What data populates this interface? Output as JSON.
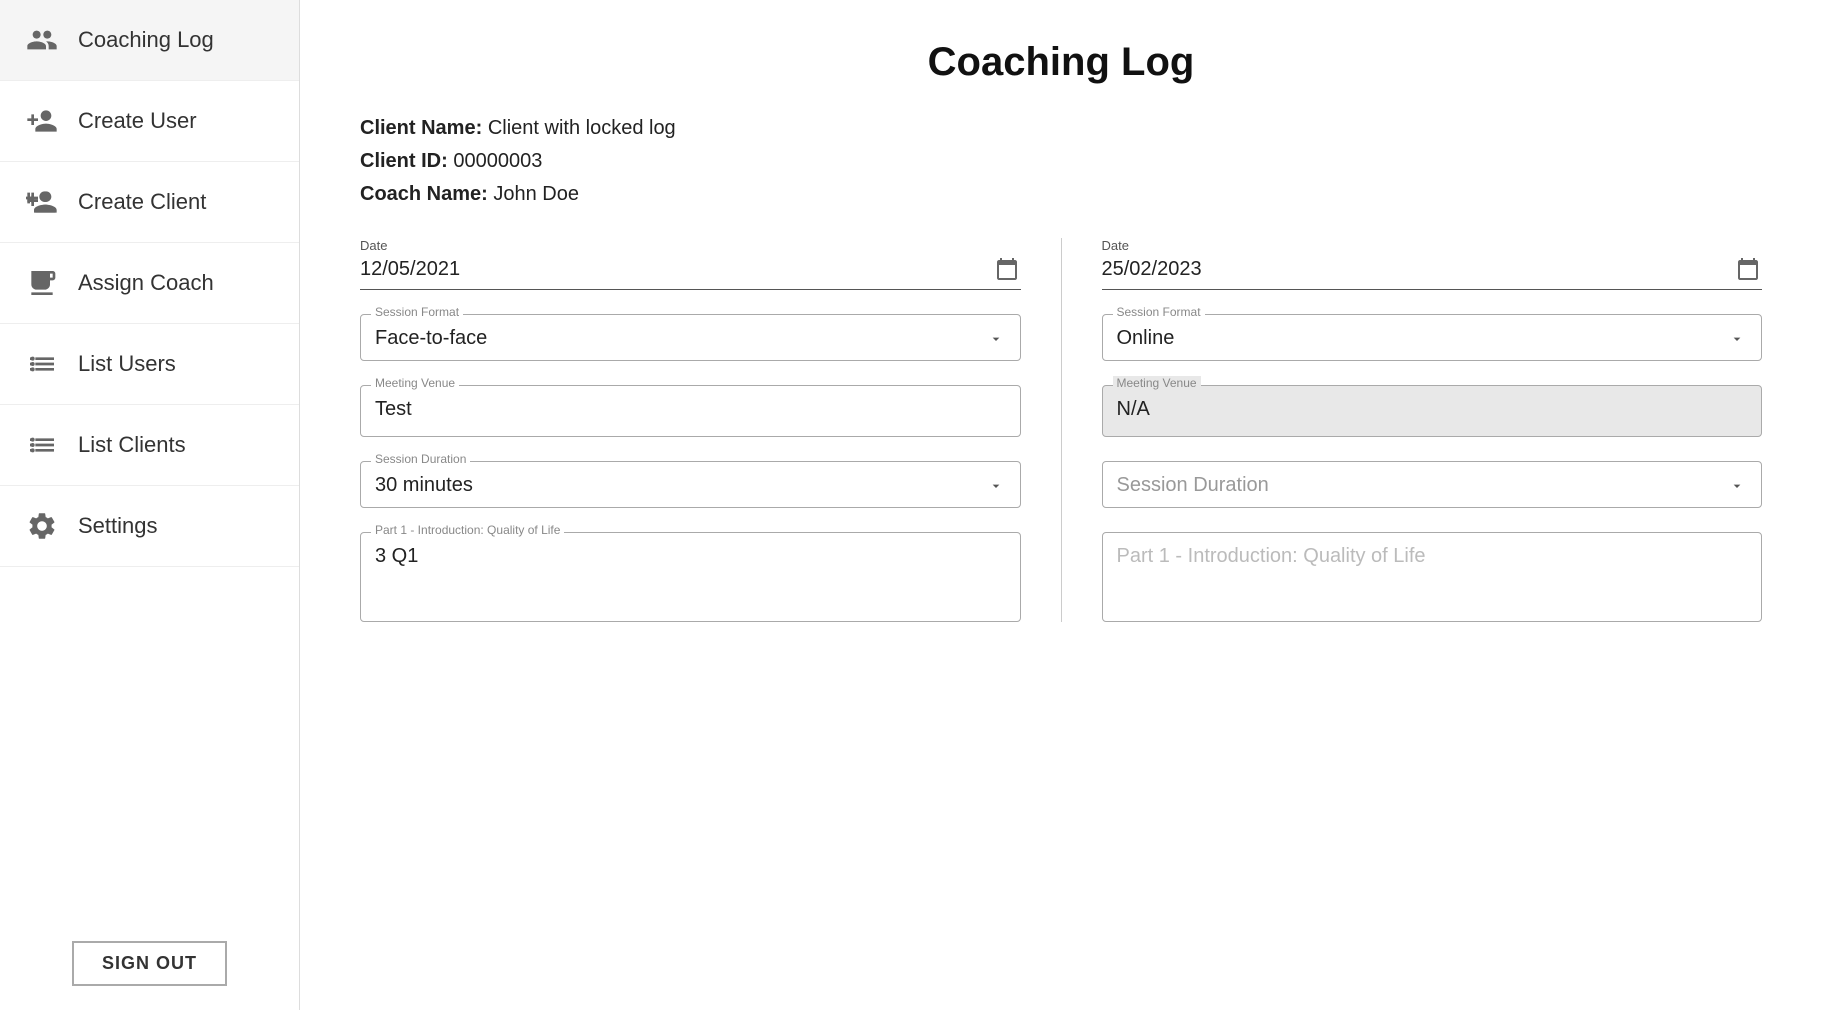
{
  "sidebar": {
    "items": [
      {
        "id": "coaching-log",
        "label": "Coaching Log",
        "icon": "coaching-log-icon"
      },
      {
        "id": "create-user",
        "label": "Create User",
        "icon": "create-user-icon"
      },
      {
        "id": "create-client",
        "label": "Create Client",
        "icon": "create-client-icon"
      },
      {
        "id": "assign-coach",
        "label": "Assign Coach",
        "icon": "assign-coach-icon"
      },
      {
        "id": "list-users",
        "label": "List Users",
        "icon": "list-users-icon"
      },
      {
        "id": "list-clients",
        "label": "List Clients",
        "icon": "list-clients-icon"
      },
      {
        "id": "settings",
        "label": "Settings",
        "icon": "settings-icon"
      }
    ],
    "sign_out_label": "SIGN OUT"
  },
  "page": {
    "title": "Coaching Log",
    "client_name_label": "Client Name:",
    "client_name_value": "Client with locked log",
    "client_id_label": "Client ID:",
    "client_id_value": "00000003",
    "coach_name_label": "Coach Name:",
    "coach_name_value": "John Doe"
  },
  "left_column": {
    "date_label": "Date",
    "date_value": "12/05/2021",
    "session_format_label": "Session Format",
    "session_format_value": "Face-to-face",
    "meeting_venue_label": "Meeting Venue",
    "meeting_venue_value": "Test",
    "session_duration_label": "Session Duration",
    "session_duration_value": "30 minutes",
    "part1_label": "Part 1 - Introduction: Quality of Life",
    "part1_value": "3 Q1"
  },
  "right_column": {
    "date_label": "Date",
    "date_value": "25/02/2023",
    "session_format_label": "Session Format",
    "session_format_value": "Online",
    "meeting_venue_label": "Meeting Venue",
    "meeting_venue_value": "N/A",
    "session_duration_label": "Session Duration",
    "session_duration_value": "",
    "part1_label": "Part 1 - Introduction: Quality of Life",
    "part1_value": ""
  },
  "icons": {
    "calendar": "📅",
    "dropdown_arrow": "▼"
  }
}
